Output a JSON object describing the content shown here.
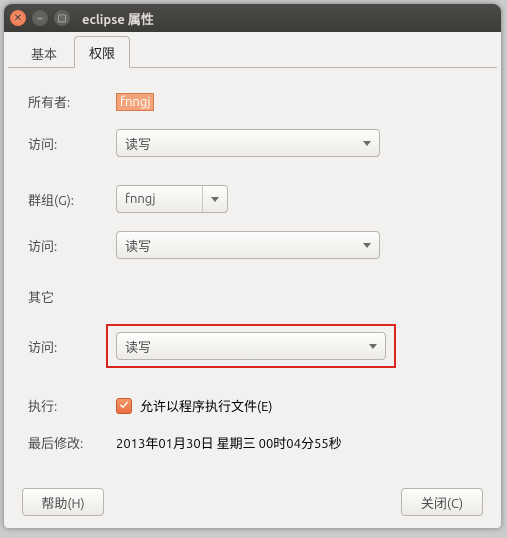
{
  "window": {
    "title": "eclipse 属性"
  },
  "tabs": {
    "basic": "基本",
    "permissions": "权限"
  },
  "labels": {
    "owner": "所有者:",
    "access": "访问:",
    "group": "群组(G):",
    "others": "其它",
    "execute": "执行:",
    "modified": "最后修改:"
  },
  "values": {
    "owner": "fnngj",
    "owner_access": "读写",
    "group": "fnngj",
    "group_access": "读写",
    "others_access": "读写",
    "execute_label": "允许以程序执行文件(E)",
    "modified": "2013年01月30日 星期三 00时04分55秒"
  },
  "buttons": {
    "help": "帮助(H)",
    "close": "关闭(C)"
  }
}
